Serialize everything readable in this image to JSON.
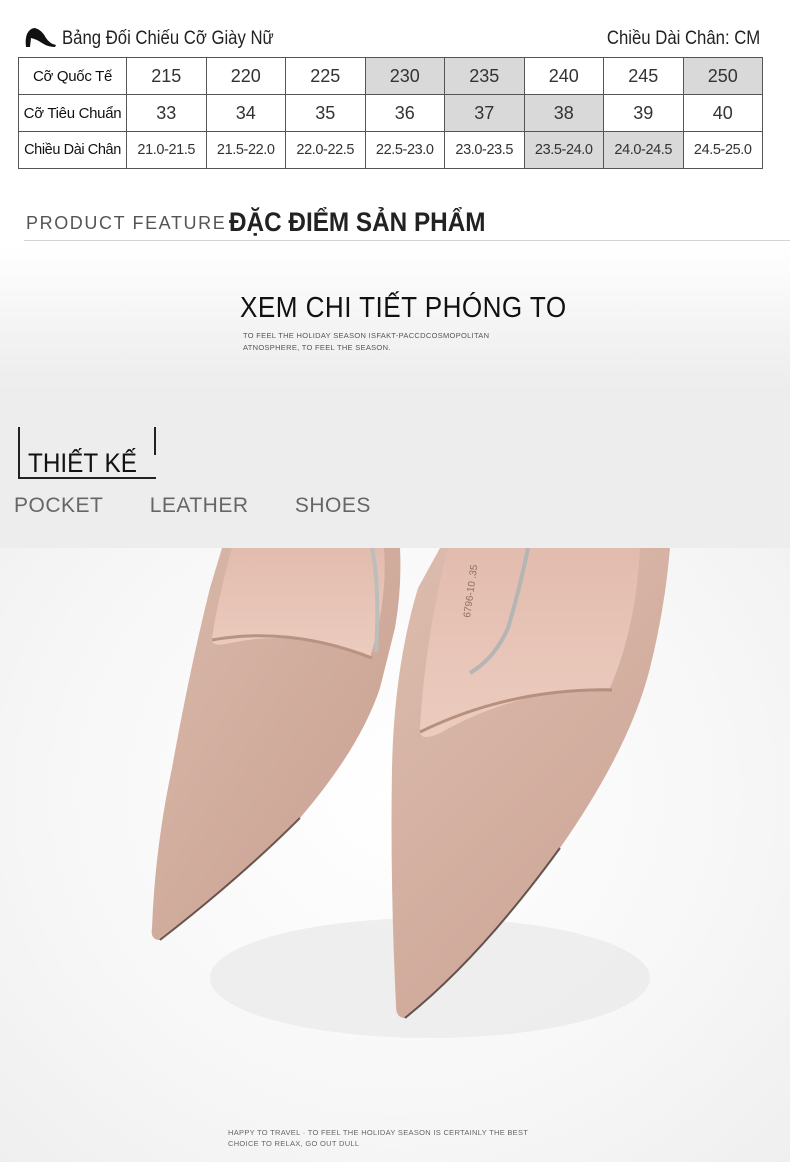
{
  "size_chart": {
    "title": "Bảng Đối Chiếu Cỡ Giày Nữ",
    "unit_label": "Chiều Dài Chân: CM",
    "icon": "high-heel-icon",
    "rows": [
      {
        "label": "Cỡ Quốc Tế",
        "cells": [
          "215",
          "220",
          "225",
          "230",
          "235",
          "240",
          "245",
          "250"
        ],
        "shaded": [
          false,
          false,
          false,
          true,
          true,
          false,
          false,
          true
        ]
      },
      {
        "label": "Cỡ Tiêu Chuẩn",
        "cells": [
          "33",
          "34",
          "35",
          "36",
          "37",
          "38",
          "39",
          "40"
        ],
        "shaded": [
          false,
          false,
          false,
          false,
          true,
          true,
          false,
          false
        ]
      },
      {
        "label": "Chiều Dài Chân",
        "cells": [
          "21.0-21.5",
          "21.5-22.0",
          "22.0-22.5",
          "22.5-23.0",
          "23.0-23.5",
          "23.5-24.0",
          "24.0-24.5",
          "24.5-25.0"
        ],
        "shaded": [
          false,
          false,
          false,
          false,
          false,
          true,
          true,
          false
        ]
      }
    ]
  },
  "feature": {
    "label_en": "PRODUCT FEATURE",
    "label_vn": "ĐẶC ĐIỂM SẢN PHẨM"
  },
  "zoom": {
    "title": "XEM CHI TIẾT PHÓNG TO",
    "sub_line1": "TO FEEL THE HOLIDAY SEASON ISFAKT-PACCDCOSMOPOLITAN",
    "sub_line2": "ATNOSPHERE, TO FEEL THE SEASON."
  },
  "design": {
    "title": "THIẾT KẾ",
    "words": [
      "POCKET",
      "LEATHER",
      "SHOES"
    ]
  },
  "photo": {
    "caption_line1": "HAPPY TO TRAVEL · TO FEEL THE HOLIDAY SEASON IS CERTAINLY THE BEST",
    "caption_line2": "CHOICE TO RELAX, GO OUT DULL",
    "colors": {
      "suede": "#d7b5a6",
      "suede_shadow": "#b99384",
      "lining": "#e9c6b7",
      "background": "#f5f5f5"
    }
  },
  "colors": {
    "shaded_cell": "#d9d9d9",
    "design_band": "#ededed",
    "text": "#222222"
  }
}
